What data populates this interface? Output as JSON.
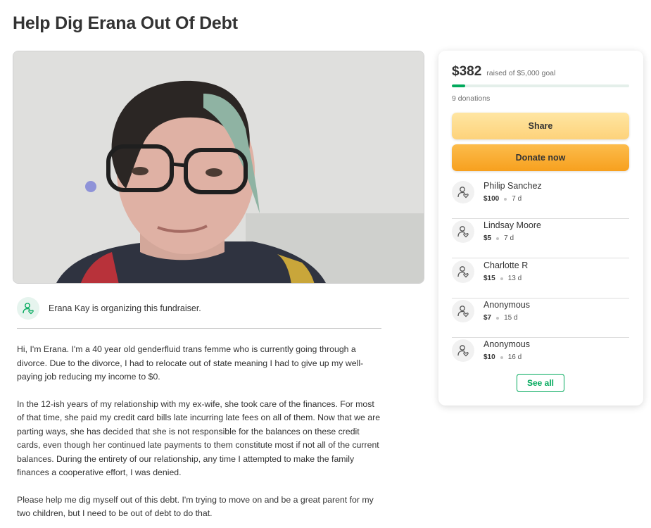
{
  "campaign": {
    "title": "Help Dig Erana Out Of Debt"
  },
  "hero": {
    "icon": "organizer-photo"
  },
  "organizer": {
    "text": "Erana Kay is organizing this fundraiser.",
    "icon": "user-heart-icon"
  },
  "story": {
    "paragraphs": [
      "Hi, I'm Erana. I'm a 40 year old genderfluid trans femme who is currently going through a divorce. Due to the divorce, I had to relocate out of state meaning I had to give up my well-paying job reducing my income to $0.",
      "In the 12-ish years of my relationship with my ex-wife, she took care of the finances. For most of that time, she paid my credit card bills late incurring late fees on all of them. Now that we are parting ways, she has decided that she is not responsible for the balances on these credit cards, even though her continued late payments to them constitute most if not all of the current balances. During the entirety of our relationship, any time I attempted to make the family finances a cooperative effort, I was denied.",
      "Please help me dig myself out of this debt. I'm trying to move on and be a great parent for my two children, but I need to be out of debt to do that."
    ]
  },
  "panel": {
    "raised_amount": "$382",
    "raised_goal_text": "raised of $5,000 goal",
    "progress_fraction": 0.0764,
    "donation_count": "9 donations",
    "share_label": "Share",
    "donate_label": "Donate now",
    "see_all_label": "See all",
    "accent_color": "#02a95c",
    "donors": [
      {
        "name": "Philip Sanchez",
        "amount": "$100",
        "time": "7 d"
      },
      {
        "name": "Lindsay Moore",
        "amount": "$5",
        "time": "7 d"
      },
      {
        "name": "Charlotte R",
        "amount": "$15",
        "time": "13 d"
      },
      {
        "name": "Anonymous",
        "amount": "$7",
        "time": "15 d"
      },
      {
        "name": "Anonymous",
        "amount": "$10",
        "time": "16 d"
      }
    ]
  }
}
